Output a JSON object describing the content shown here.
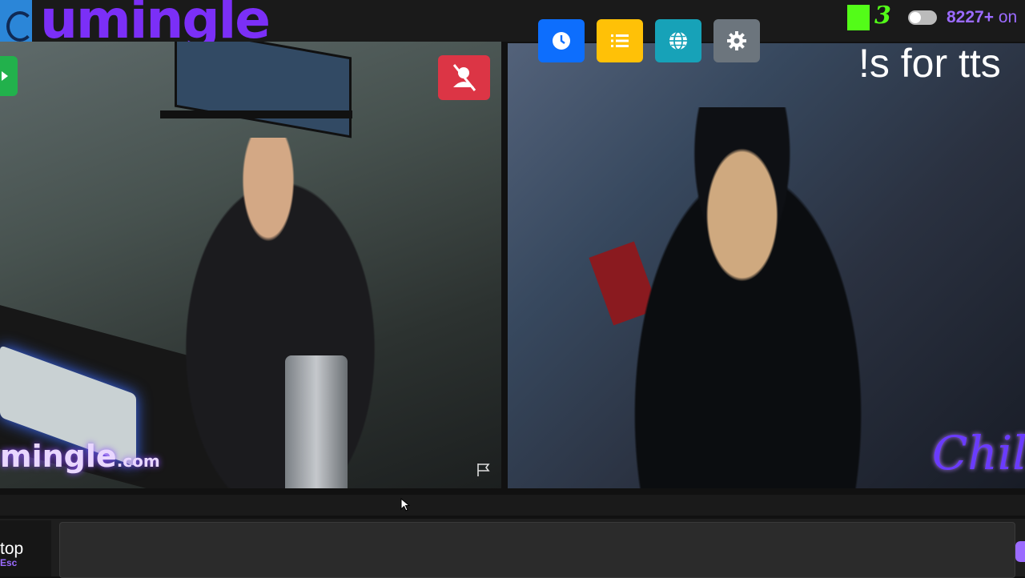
{
  "header": {
    "logo_text": "umingle",
    "online_count": "8227+",
    "online_suffix": "on",
    "kick_count": "3"
  },
  "toolbar": [
    {
      "name": "history-button",
      "icon": "clock-icon",
      "color": "#0d6efd"
    },
    {
      "name": "list-button",
      "icon": "list-icon",
      "color": "#ffc107"
    },
    {
      "name": "globe-button",
      "icon": "globe-icon",
      "color": "#17a2b8"
    },
    {
      "name": "settings-button",
      "icon": "gear-icon",
      "color": "#6c757d"
    }
  ],
  "overlay": {
    "tts_text": "!s for tts",
    "left_watermark": "mingle",
    "left_watermark_suffix": ".com",
    "right_watermark": "Chill"
  },
  "controls": {
    "stop_label": "top",
    "stop_key": "Esc",
    "mute_icon": "user-slash-icon",
    "report_icon": "flag-icon"
  },
  "colors": {
    "brand": "#7b2ff7",
    "kick_green": "#53fc18",
    "accent_purple": "#9b6bff",
    "mute_red": "#dc3545"
  }
}
